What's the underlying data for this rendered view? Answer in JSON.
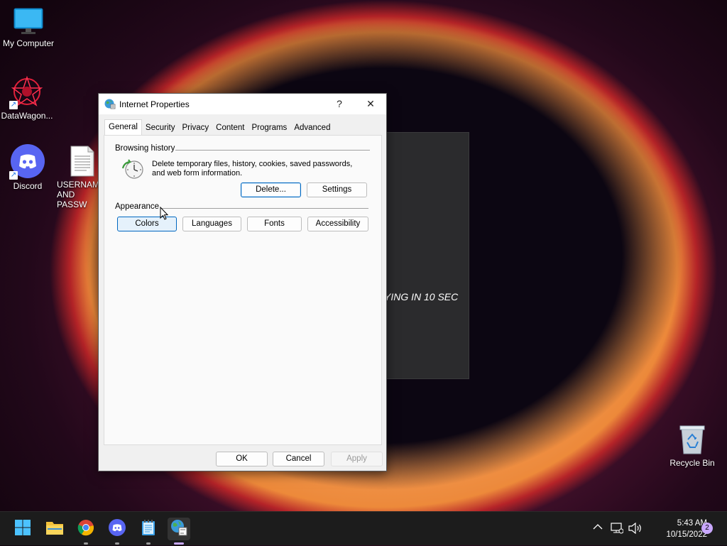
{
  "desktop": {
    "icons": [
      {
        "label": "My Computer"
      },
      {
        "label": "DataWagon..."
      },
      {
        "label": "Discord"
      },
      {
        "label_line1": "USERNAM",
        "label_line2": "AND PASSW"
      },
      {
        "label": "Recycle Bin"
      }
    ]
  },
  "overlay_window": {
    "text": "YING IN 10 SEC"
  },
  "dialog": {
    "title": "Internet Properties",
    "help_label": "?",
    "close_label": "✕",
    "tabs": [
      "General",
      "Security",
      "Privacy",
      "Content",
      "Programs",
      "Advanced"
    ],
    "active_tab": "General",
    "browsing_history": {
      "title": "Browsing history",
      "description": "Delete temporary files, history, cookies, saved passwords, and web form information.",
      "delete_label": "Delete...",
      "settings_label": "Settings"
    },
    "appearance": {
      "title": "Appearance",
      "colors_label": "Colors",
      "languages_label": "Languages",
      "fonts_label": "Fonts",
      "accessibility_label": "Accessibility"
    },
    "footer": {
      "ok_label": "OK",
      "cancel_label": "Cancel",
      "apply_label": "Apply"
    }
  },
  "taskbar": {
    "apps": [
      "start-icon",
      "file-explorer-icon",
      "chrome-icon",
      "discord-icon",
      "notepad-icon",
      "internet-properties-icon"
    ],
    "clock_time": "5:43 AM",
    "clock_date": "10/15/2022",
    "notification_count": "2"
  },
  "colors": {
    "accent": "#0067c0",
    "taskbar": "#1c1c1c",
    "dialog_bg": "#f0f0f0"
  }
}
